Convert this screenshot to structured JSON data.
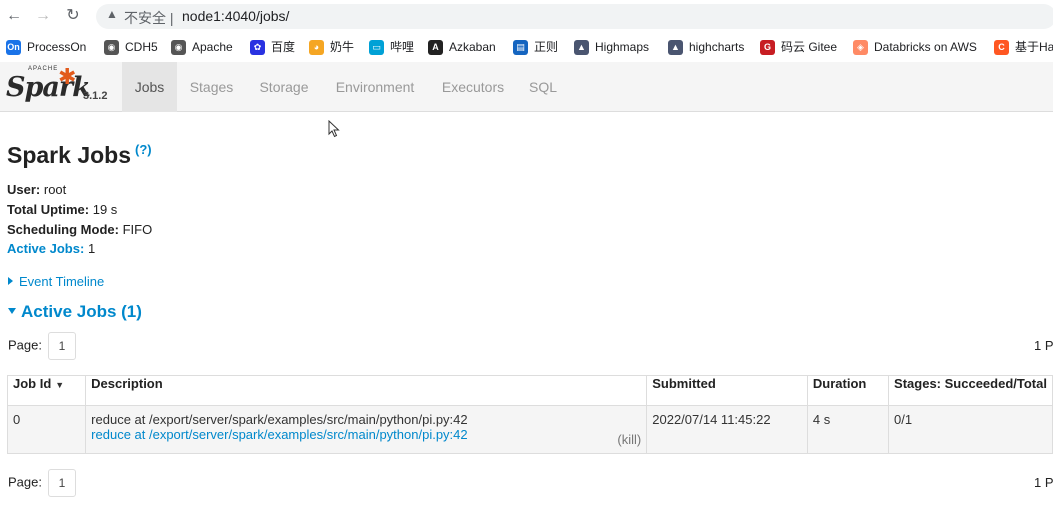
{
  "browser": {
    "back_icon": "←",
    "forward_icon": "→",
    "reload_icon": "↻",
    "warning_icon": "▲",
    "security_text": "不安全 |",
    "url": "node1:4040/jobs/"
  },
  "bookmarks": [
    {
      "label": "ProcessOn",
      "icon": "On",
      "color": "#1a73e8"
    },
    {
      "label": "CDH5",
      "icon": "◉",
      "color": "#555555"
    },
    {
      "label": "Apache",
      "icon": "◉",
      "color": "#555555"
    },
    {
      "label": "百度",
      "icon": "✿",
      "color": "#2932e1"
    },
    {
      "label": "奶牛",
      "icon": "◕",
      "color": "#f5a623"
    },
    {
      "label": "哔哩",
      "icon": "▭",
      "color": "#00a1d6"
    },
    {
      "label": "Azkaban",
      "icon": "A",
      "color": "#222222"
    },
    {
      "label": "正则",
      "icon": "▤",
      "color": "#1565c0"
    },
    {
      "label": "Highmaps",
      "icon": "▲",
      "color": "#4a5570"
    },
    {
      "label": "highcharts",
      "icon": "▲",
      "color": "#4a5570"
    },
    {
      "label": "码云 Gitee",
      "icon": "G",
      "color": "#c71d23"
    },
    {
      "label": "Databricks on AWS",
      "icon": "◈",
      "color": "#ff8a65"
    },
    {
      "label": "基于Ha",
      "icon": "C",
      "color": "#ff5722"
    }
  ],
  "spark": {
    "apache": "APACHE",
    "logo_text": "Spark",
    "version": "3.1.2",
    "tabs": [
      {
        "label": "Jobs",
        "active": true
      },
      {
        "label": "Stages",
        "active": false
      },
      {
        "label": "Storage",
        "active": false
      },
      {
        "label": "Environment",
        "active": false
      },
      {
        "label": "Executors",
        "active": false
      },
      {
        "label": "SQL",
        "active": false
      }
    ]
  },
  "page": {
    "title": "Spark Jobs",
    "help": "(?)",
    "user_label": "User:",
    "user_value": "root",
    "uptime_label": "Total Uptime:",
    "uptime_value": "19 s",
    "scheduling_label": "Scheduling Mode:",
    "scheduling_value": "FIFO",
    "active_jobs_label": "Active Jobs:",
    "active_jobs_value": "1",
    "event_timeline": "Event Timeline",
    "active_jobs_heading": "Active Jobs (1)",
    "page_label": "Page:",
    "page_number": "1",
    "pages_right": "1 P"
  },
  "table": {
    "headers": [
      "Job Id",
      "Description",
      "Submitted",
      "Duration",
      "Stages: Succeeded/Total"
    ],
    "sort_icon": "▼",
    "rows": [
      {
        "job_id": "0",
        "description": "reduce at /export/server/spark/examples/src/main/python/pi.py:42",
        "description_link": "reduce at /export/server/spark/examples/src/main/python/pi.py:42",
        "kill": "(kill)",
        "submitted": "2022/07/14 11:45:22",
        "duration": "4 s",
        "stages": "0/1"
      }
    ]
  }
}
